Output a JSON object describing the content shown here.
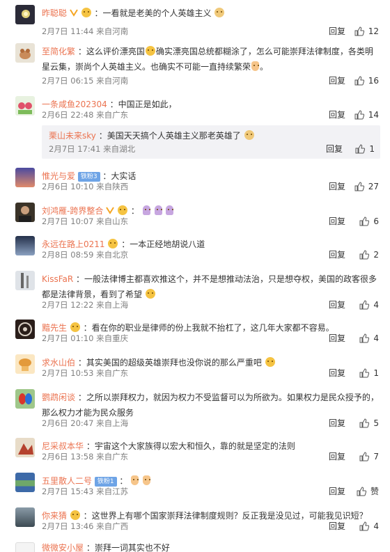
{
  "reply_label": "回复",
  "comments": [
    {
      "name": "昨聪聪",
      "text": "：一看就是老美的个人英雄主义",
      "time": "2月7日 11:44 来自河南",
      "likes": "12"
    },
    {
      "name": "至简化繁",
      "text": "：这么评价漂亮国",
      "text2": "确实漂亮国总统都糊涂了，怎么可能崇拜法律制度，各类明星云集，崇尚个人英雄主义。也确实不可能一直持续繁荣",
      "text3": "。",
      "time": "2月7日 06:15 来自河南",
      "likes": "16"
    },
    {
      "name": "一条咸鱼202304",
      "text": "：中国正是如此，",
      "time": "2月6日 22:48 来自广东",
      "likes": "14"
    },
    {
      "name": "栗山未来sky",
      "text": "：美国天天搞个人英雄主义那老英雄了",
      "time": "2月7日 17:41 来自湖北",
      "likes": "1"
    },
    {
      "name": "惟光与爱",
      "badge": "铁粉3",
      "text": "：大实话",
      "time": "2月6日 10:10 来自陕西",
      "likes": "27"
    },
    {
      "name": "刘鸿雁-跨界整合",
      "text": "：",
      "time": "2月7日 10:07 来自山东",
      "likes": "6"
    },
    {
      "name": "永远在路上0211",
      "text": "：一本正经地胡说八道",
      "time": "2月8日 08:59 来自北京",
      "likes": "2"
    },
    {
      "name": "KissFaR",
      "text": "：一般法律博主都喜欢推这个，并不是想推动法治，只是想夺权，美国的政客很多都是法律背景，看到了希望",
      "time": "2月7日 12:22 来自上海",
      "likes": "4"
    },
    {
      "name": "黯先生",
      "text": "：看在你的职业是律师的份上我就不抬杠了，这几年大家都不容易。",
      "time": "2月7日 01:10 来自重庆",
      "likes": "4"
    },
    {
      "name": "求水山伯",
      "text": "：其实美国的超级英雄崇拜也没你说的那么严重吧",
      "time": "2月7日 10:53 来自广东",
      "likes": "1"
    },
    {
      "name": "鹦鹉闲谈",
      "text": "：之所以崇拜权力，就因为权力不受监督可以为所欲为。如果权力是民众授予的，那么权力才能为民众服务",
      "time": "2月6日 20:47 来自上海",
      "likes": "5"
    },
    {
      "name": "尼采叔本华",
      "text": "：宇宙这个大家族得以宏大和恒久，靠的就是坚定的法则",
      "time": "2月6日 13:58 来自广东",
      "likes": "7"
    },
    {
      "name": "五里散人二号",
      "badge": "铁粉1",
      "text": "：",
      "time": "2月7日 15:43 来自江苏",
      "likes": "赞"
    },
    {
      "name": "你来猜",
      "text": "：这世界上有哪个国家崇拜法律制度规则？反正我是没见过，可能我见识短？",
      "time": "2月7日 13:46 来自广西",
      "likes": "4"
    },
    {
      "name": "微微安小屋",
      "text": "：崇拜一词其实也不好",
      "time": "",
      "likes": ""
    }
  ]
}
